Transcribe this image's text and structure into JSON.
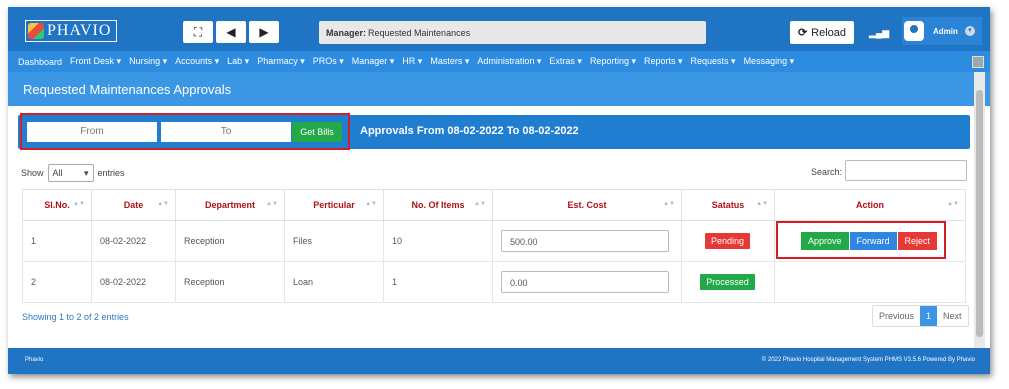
{
  "header": {
    "logo_text": "PHAVIO",
    "expand_glyph": "⛶",
    "back_glyph": "🡄",
    "forward_glyph": "🡆",
    "manager_label": "Manager:",
    "manager_value": "Requested Maintenances",
    "reload_label": "Reload",
    "reload_glyph": "⟳",
    "signal_glyph": "📶",
    "user_name": "Admin"
  },
  "nav": [
    "Dashboard",
    "Front Desk ▾",
    "Nursing ▾",
    "Accounts ▾",
    "Lab ▾",
    "Pharmacy ▾",
    "PROs ▾",
    "Manager ▾",
    "HR ▾",
    "Masters ▾",
    "Administration ▾",
    "Extras ▾",
    "Reporting ▾",
    "Reports ▾",
    "Requests ▾",
    "Messaging ▾"
  ],
  "page_title": "Requested Maintenances Approvals",
  "filter": {
    "from_placeholder": "From",
    "to_placeholder": "To",
    "get_bills_label": "Get Bills",
    "approvals_label": "Approvals From 08-02-2022 To 08-02-2022"
  },
  "table_controls": {
    "show_label": "Show",
    "show_value": "All",
    "entries_label": "entries",
    "search_label": "Search:"
  },
  "table": {
    "headers": [
      "Sl.No.",
      "Date",
      "Department",
      "Perticular",
      "No. Of Items",
      "Est. Cost",
      "Satatus",
      "Action"
    ],
    "rows": [
      {
        "sl": "1",
        "date": "08-02-2022",
        "dept": "Reception",
        "particular": "Files",
        "items": "10",
        "cost": "500.00",
        "status": "Pending"
      },
      {
        "sl": "2",
        "date": "08-02-2022",
        "dept": "Reception",
        "particular": "Loan",
        "items": "1",
        "cost": "0.00",
        "status": "Processed"
      }
    ],
    "actions": {
      "approve": "Approve",
      "forward": "Forward",
      "reject": "Reject"
    }
  },
  "pagination": {
    "showing": "Showing 1 to 2 of 2 entries",
    "previous": "Previous",
    "page": "1",
    "next": "Next"
  },
  "footer": {
    "left": "Phavio",
    "right": "© 2022 Phavio Hospital Management System PHMS V3.5.6 Powered By Phavio"
  },
  "colors": {
    "header_blue": "#1f74c4",
    "nav_blue": "#2d8be0",
    "pending_red": "#e53935",
    "processed_green": "#23a94a",
    "forward_blue": "#2e86de",
    "highlight_red": "#d21e24"
  }
}
